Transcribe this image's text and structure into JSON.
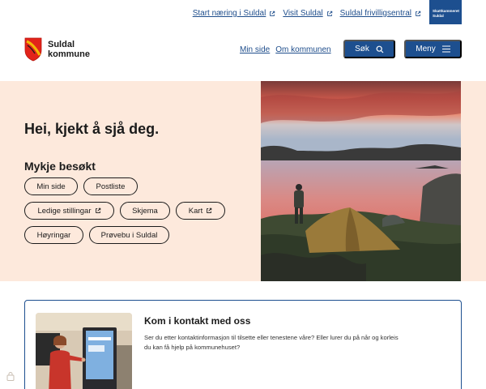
{
  "topbar": {
    "links": [
      {
        "label": "Start næring i Suldal"
      },
      {
        "label": "Visit Suldal"
      },
      {
        "label": "Suldal frivilligsentral"
      }
    ],
    "badge_line1": "Skattkammeret",
    "badge_line2": "Suldal"
  },
  "header": {
    "logo_line1": "Suldal",
    "logo_line2": "kommune",
    "nav": [
      {
        "label": "Min side"
      },
      {
        "label": "Om kommunen"
      }
    ],
    "search_label": "Søk",
    "menu_label": "Meny"
  },
  "hero": {
    "title": "Hei, kjekt å sjå deg.",
    "popular_title": "Mykje besøkt",
    "chips": [
      {
        "label": "Min side"
      },
      {
        "label": "Postliste"
      },
      {
        "label": "Ledige stillingar"
      },
      {
        "label": "Skjema"
      },
      {
        "label": "Kart"
      },
      {
        "label": "Høyringar"
      },
      {
        "label": "Prøvebu i Suldal"
      }
    ]
  },
  "contact": {
    "title": "Kom i kontakt med oss",
    "text": "Ser du etter kontaktinformasjon til tilsette eller tenestene våre? Eller lurer du på når og korleis du kan få hjelp på kommunehuset?"
  },
  "colors": {
    "brand_blue": "#1d4f8f",
    "link_blue": "#1f4e8c",
    "hero_bg": "#fde9dc",
    "shield_red": "#e2231a",
    "shield_gold": "#f2b705"
  }
}
